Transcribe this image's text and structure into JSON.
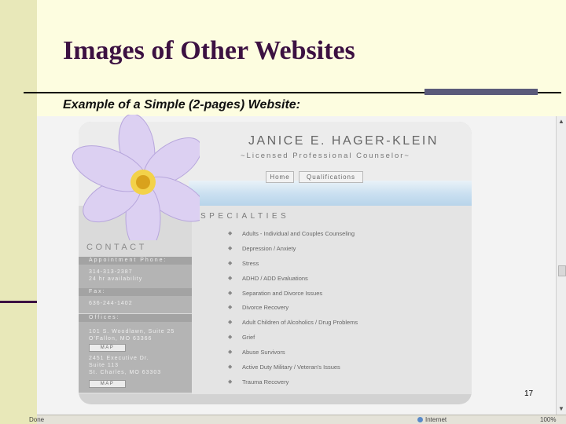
{
  "slide": {
    "title": "Images of Other Websites",
    "subtitle": "Example of a Simple (2-pages) Website:",
    "page_number": "17"
  },
  "site": {
    "name": "JANICE E. HAGER-KLEIN",
    "tagline": "~Licensed Professional Counselor~",
    "nav": [
      "Home",
      "Qualifications"
    ],
    "contact_heading": "CONTACT",
    "contact": {
      "appointment_label": "Appointment Phone:",
      "appointment_lines": [
        "314-313-2387",
        "24 hr availability"
      ],
      "fax_label": "Fax:",
      "fax_value": "636-244-1402",
      "offices_label": "Offices:",
      "office1": [
        "101 S. Woodlawn, Suite 25",
        "O'Fallon, MO 63366"
      ],
      "office2": [
        "2451 Executive Dr.",
        "Suite 113",
        "St. Charles, MO 63303"
      ],
      "map_label": "MAP"
    },
    "specialties_heading": "SPECIALTIES",
    "specialties": [
      "Adults - Individual and Couples Counseling",
      "Depression / Anxiety",
      "Stress",
      "ADHD / ADD Evaluations",
      "Separation and Divorce Issues",
      "Divorce Recovery",
      "Adult Children of Alcoholics / Drug Problems",
      "Grief",
      "Abuse Survivors",
      "Active Duty Military / Veteran's Issues",
      "Trauma Recovery"
    ]
  },
  "browser": {
    "status_left": "Done",
    "status_zone": "Internet",
    "zoom": "100%"
  },
  "colors": {
    "title": "#3c1142",
    "slide_bg": "#fdfde0",
    "left_band": "#e8e8b9"
  }
}
